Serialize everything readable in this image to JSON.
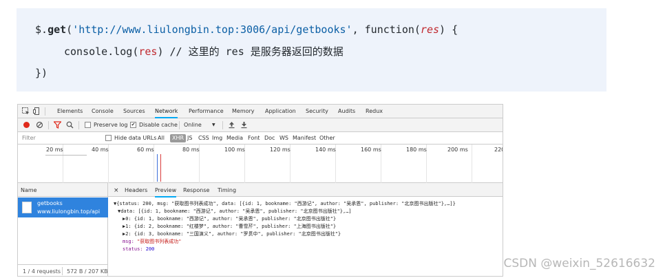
{
  "code": {
    "line1": {
      "prefix": "$.",
      "method": "get",
      "open": "(",
      "quote_open": "'",
      "url": "http://www.liulongbin.top:3006/api/getbooks",
      "quote_close": "'",
      "mid": ", function(",
      "param": "res",
      "close": ") {"
    },
    "line2": {
      "call": "console.log(",
      "arg": "res",
      "comment": ") // 这里的 res 是服务器返回的数据"
    },
    "line3": {
      "text": "})"
    }
  },
  "devtools": {
    "tabs": [
      "Elements",
      "Console",
      "Sources",
      "Network",
      "Performance",
      "Memory",
      "Application",
      "Security",
      "Audits",
      "Redux"
    ],
    "active_tab": "Network",
    "toolbar": {
      "preserve_log": "Preserve log",
      "disable_cache": "Disable cache",
      "throttle": "Online",
      "throttle_arrow": "▼",
      "disable_cache_checked": "✔"
    },
    "filter": {
      "placeholder": "Filter",
      "hide_data_urls": "Hide data URLs",
      "types": [
        "All",
        "XHR",
        "JS",
        "CSS",
        "Img",
        "Media",
        "Font",
        "Doc",
        "WS",
        "Manifest",
        "Other"
      ],
      "active_type": "XHR"
    },
    "timeline_ticks": [
      "20 ms",
      "40 ms",
      "60 ms",
      "80 ms",
      "100 ms",
      "120 ms",
      "140 ms",
      "160 ms",
      "180 ms",
      "200 ms",
      "220"
    ],
    "name_header": "Name",
    "request": {
      "name": "getbooks",
      "domain": "www.liulongbin.top/api"
    },
    "status": {
      "requests": "1 / 4 requests",
      "size": "572 B / 207 KB"
    },
    "detail_tabs": {
      "close": "×",
      "items": [
        "Headers",
        "Preview",
        "Response",
        "Timing"
      ],
      "active": "Preview"
    },
    "preview": {
      "line1": "▼{status: 200, msg: \"获取图书列表成功\", data: [{id: 1, bookname: \"西游记\", author: \"吴承恩\", publisher: \"北京图书出版社\"},…]}",
      "line2": "▼data: [{id: 1, bookname: \"西游记\", author: \"吴承恩\", publisher: \"北京图书出版社\"},…]",
      "line3": "▶0: {id: 1, bookname: \"西游记\", author: \"吴承恩\", publisher: \"北京图书出版社\"}",
      "line4": "▶1: {id: 2, bookname: \"红楼梦\", author: \"曹雪芹\", publisher: \"上海图书出版社\"}",
      "line5": "▶2: {id: 3, bookname: \"三国演义\", author: \"罗贯中\", publisher: \"北京图书出版社\"}",
      "msg_key": "msg:",
      "msg_val": "\"获取图书列表成功\"",
      "status_key": "status:",
      "status_val": "200"
    }
  },
  "watermark": "CSDN @weixin_52616632"
}
